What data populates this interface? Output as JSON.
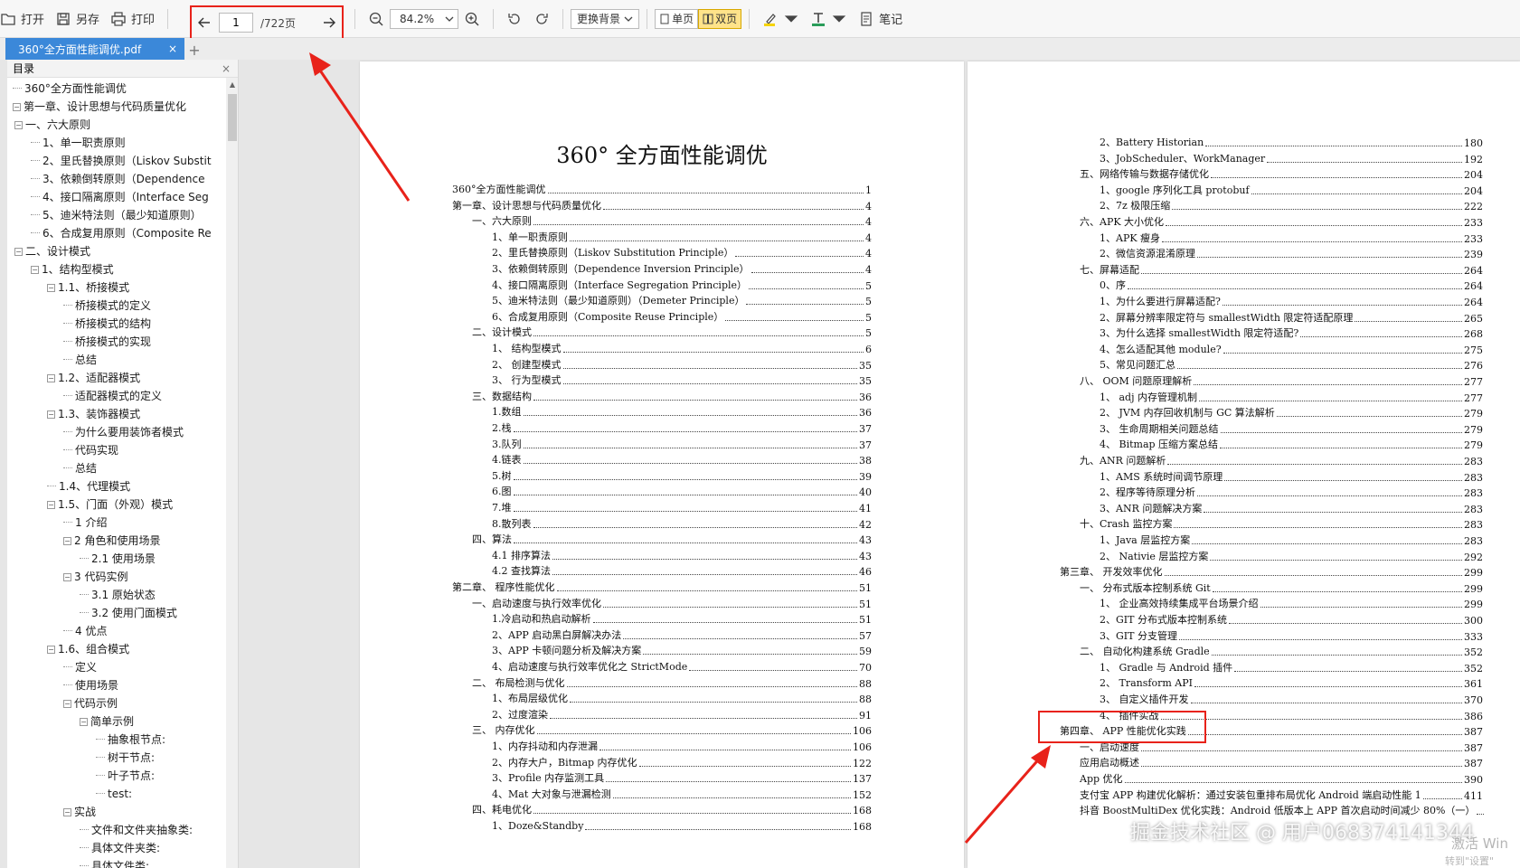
{
  "toolbar": {
    "open_label": "打开",
    "save_as_label": "另存",
    "print_label": "打印",
    "page_current": "1",
    "page_total": "/722页",
    "zoom": "84.2%",
    "background_label": "更换背景",
    "single_page_label": "单页",
    "double_page_label": "双页",
    "note_label": "笔记"
  },
  "tab": {
    "name": "360°全方面性能调优.pdf",
    "close": "×",
    "add": "+"
  },
  "sidebar": {
    "title": "目录",
    "close": "×",
    "items": [
      {
        "text": "360°全方面性能调优",
        "level": 0,
        "exp": ""
      },
      {
        "text": "第一章、设计思想与代码质量优化",
        "level": 0,
        "exp": "−"
      },
      {
        "text": "一、六大原则",
        "level": 1,
        "exp": "−"
      },
      {
        "text": "1、单一职责原则",
        "level": 2,
        "exp": ""
      },
      {
        "text": "2、里氏替换原则（Liskov Substit",
        "level": 2,
        "exp": ""
      },
      {
        "text": "3、依赖倒转原则（Dependence",
        "level": 2,
        "exp": ""
      },
      {
        "text": "4、接口隔离原则（Interface Seg",
        "level": 2,
        "exp": ""
      },
      {
        "text": "5、迪米特法则（最少知道原则）",
        "level": 2,
        "exp": ""
      },
      {
        "text": "6、合成复用原则（Composite Re",
        "level": 2,
        "exp": ""
      },
      {
        "text": "二、设计模式",
        "level": 1,
        "exp": "−"
      },
      {
        "text": "1、结构型模式",
        "level": 2,
        "exp": "−"
      },
      {
        "text": "1.1、桥接模式",
        "level": 3,
        "exp": "−"
      },
      {
        "text": "桥接模式的定义",
        "level": 4,
        "exp": ""
      },
      {
        "text": "桥接模式的结构",
        "level": 4,
        "exp": ""
      },
      {
        "text": "桥接模式的实现",
        "level": 4,
        "exp": ""
      },
      {
        "text": "总结",
        "level": 4,
        "exp": ""
      },
      {
        "text": "1.2、适配器模式",
        "level": 3,
        "exp": "−"
      },
      {
        "text": "适配器模式的定义",
        "level": 4,
        "exp": ""
      },
      {
        "text": "1.3、装饰器模式",
        "level": 3,
        "exp": "−"
      },
      {
        "text": "为什么要用装饰者模式",
        "level": 4,
        "exp": ""
      },
      {
        "text": "代码实现",
        "level": 4,
        "exp": ""
      },
      {
        "text": "总结",
        "level": 4,
        "exp": ""
      },
      {
        "text": "1.4、代理模式",
        "level": 3,
        "exp": ""
      },
      {
        "text": "1.5、门面（外观）模式",
        "level": 3,
        "exp": "−"
      },
      {
        "text": "1 介绍",
        "level": 4,
        "exp": ""
      },
      {
        "text": "2 角色和使用场景",
        "level": 4,
        "exp": "−"
      },
      {
        "text": "2.1 使用场景",
        "level": 5,
        "exp": ""
      },
      {
        "text": "3 代码实例",
        "level": 4,
        "exp": "−"
      },
      {
        "text": "3.1 原始状态",
        "level": 5,
        "exp": ""
      },
      {
        "text": "3.2 使用门面模式",
        "level": 5,
        "exp": ""
      },
      {
        "text": "4 优点",
        "level": 4,
        "exp": ""
      },
      {
        "text": "1.6、组合模式",
        "level": 3,
        "exp": "−"
      },
      {
        "text": "定义",
        "level": 4,
        "exp": ""
      },
      {
        "text": "使用场景",
        "level": 4,
        "exp": ""
      },
      {
        "text": "代码示例",
        "level": 4,
        "exp": "−"
      },
      {
        "text": "简单示例",
        "level": 5,
        "exp": "−"
      },
      {
        "text": "抽象根节点:",
        "level": 6,
        "exp": ""
      },
      {
        "text": "树干节点:",
        "level": 6,
        "exp": ""
      },
      {
        "text": "叶子节点:",
        "level": 6,
        "exp": ""
      },
      {
        "text": "test:",
        "level": 6,
        "exp": ""
      },
      {
        "text": "实战",
        "level": 4,
        "exp": "−"
      },
      {
        "text": "文件和文件夹抽象类:",
        "level": 5,
        "exp": ""
      },
      {
        "text": "具体文件夹类:",
        "level": 5,
        "exp": ""
      },
      {
        "text": "具体文件类:",
        "level": 5,
        "exp": ""
      }
    ]
  },
  "left_page": {
    "title": "360° 全方面性能调优",
    "entries": [
      {
        "text": "360°全方面性能调优",
        "page": "1",
        "indent": 0
      },
      {
        "text": "第一章、设计思想与代码质量优化",
        "page": "4",
        "indent": 0
      },
      {
        "text": "一、六大原则",
        "page": "4",
        "indent": 1
      },
      {
        "text": "1、单一职责原则",
        "page": "4",
        "indent": 2
      },
      {
        "text": "2、里氏替换原则（Liskov Substitution Principle）",
        "page": "4",
        "indent": 2
      },
      {
        "text": "3、依赖倒转原则（Dependence Inversion Principle）",
        "page": "4",
        "indent": 2
      },
      {
        "text": "4、接口隔离原则（Interface Segregation Principle）",
        "page": "5",
        "indent": 2
      },
      {
        "text": "5、迪米特法则（最少知道原则）（Demeter Principle）",
        "page": "5",
        "indent": 2
      },
      {
        "text": "6、合成复用原则（Composite Reuse Principle）",
        "page": "5",
        "indent": 2
      },
      {
        "text": "二、设计模式",
        "page": "5",
        "indent": 1
      },
      {
        "text": "1、 结构型模式",
        "page": "6",
        "indent": 2
      },
      {
        "text": "2、 创建型模式",
        "page": "35",
        "indent": 2
      },
      {
        "text": "3、 行为型模式",
        "page": "35",
        "indent": 2
      },
      {
        "text": "三、数据结构",
        "page": "36",
        "indent": 1
      },
      {
        "text": "1.数组",
        "page": "36",
        "indent": 2
      },
      {
        "text": "2.栈",
        "page": "37",
        "indent": 2
      },
      {
        "text": "3.队列",
        "page": "37",
        "indent": 2
      },
      {
        "text": "4.链表",
        "page": "38",
        "indent": 2
      },
      {
        "text": "5.树",
        "page": "39",
        "indent": 2
      },
      {
        "text": "6.图",
        "page": "40",
        "indent": 2
      },
      {
        "text": "7.堆",
        "page": "41",
        "indent": 2
      },
      {
        "text": "8.散列表",
        "page": "42",
        "indent": 2
      },
      {
        "text": "四、算法",
        "page": "43",
        "indent": 1
      },
      {
        "text": "4.1 排序算法",
        "page": "43",
        "indent": 2
      },
      {
        "text": "4.2 查找算法",
        "page": "46",
        "indent": 2
      },
      {
        "text": "第二章、 程序性能优化",
        "page": "51",
        "indent": 0
      },
      {
        "text": "一、启动速度与执行效率优化",
        "page": "51",
        "indent": 1
      },
      {
        "text": "1.冷启动和热启动解析",
        "page": "51",
        "indent": 2
      },
      {
        "text": "2、APP 启动黑白屏解决办法",
        "page": "57",
        "indent": 2
      },
      {
        "text": "3、APP 卡顿问题分析及解决方案",
        "page": "59",
        "indent": 2
      },
      {
        "text": "4、启动速度与执行效率优化之 StrictMode",
        "page": "70",
        "indent": 2
      },
      {
        "text": "二、 布局检测与优化",
        "page": "88",
        "indent": 1
      },
      {
        "text": "1、布局层级优化",
        "page": "88",
        "indent": 2
      },
      {
        "text": "2、过度渲染",
        "page": "91",
        "indent": 2
      },
      {
        "text": "三、 内存优化",
        "page": "106",
        "indent": 1
      },
      {
        "text": "1、内存抖动和内存泄漏",
        "page": "106",
        "indent": 2
      },
      {
        "text": "2、内存大户，Bitmap 内存优化",
        "page": "122",
        "indent": 2
      },
      {
        "text": "3、Profile 内存监测工具",
        "page": "137",
        "indent": 2
      },
      {
        "text": "4、Mat 大对象与泄漏检测",
        "page": "152",
        "indent": 2
      },
      {
        "text": "四、耗电优化",
        "page": "168",
        "indent": 1
      },
      {
        "text": "1、Doze&Standby",
        "page": "168",
        "indent": 2
      }
    ]
  },
  "right_page": {
    "entries": [
      {
        "text": "2、Battery Historian",
        "page": "180",
        "indent": 2
      },
      {
        "text": "3、JobScheduler、WorkManager",
        "page": "192",
        "indent": 2
      },
      {
        "text": "五、网络传输与数据存储优化",
        "page": "204",
        "indent": 1
      },
      {
        "text": "1、google 序列化工具 protobuf",
        "page": "204",
        "indent": 2
      },
      {
        "text": "2、7z 极限压缩",
        "page": "222",
        "indent": 2
      },
      {
        "text": "六、APK 大小优化",
        "page": "233",
        "indent": 1
      },
      {
        "text": "1、APK 瘦身",
        "page": "233",
        "indent": 2
      },
      {
        "text": "2、微信资源混淆原理",
        "page": "239",
        "indent": 2
      },
      {
        "text": "七、屏幕适配",
        "page": "264",
        "indent": 1
      },
      {
        "text": "0、序",
        "page": "264",
        "indent": 2
      },
      {
        "text": "1、为什么要进行屏幕适配?",
        "page": "264",
        "indent": 2
      },
      {
        "text": "2、屏幕分辨率限定符与 smallestWidth 限定符适配原理",
        "page": "265",
        "indent": 2
      },
      {
        "text": "3、为什么选择 smallestWidth 限定符适配?",
        "page": "268",
        "indent": 2
      },
      {
        "text": "4、怎么适配其他 module?",
        "page": "275",
        "indent": 2
      },
      {
        "text": "5、常见问题汇总",
        "page": "276",
        "indent": 2
      },
      {
        "text": "八、 OOM 问题原理解析",
        "page": "277",
        "indent": 1
      },
      {
        "text": "1、 adj 内存管理机制",
        "page": "277",
        "indent": 2
      },
      {
        "text": "2、 JVM 内存回收机制与 GC 算法解析",
        "page": "279",
        "indent": 2
      },
      {
        "text": "3、 生命周期相关问题总结",
        "page": "279",
        "indent": 2
      },
      {
        "text": "4、 Bitmap 压缩方案总结",
        "page": "279",
        "indent": 2
      },
      {
        "text": "九、ANR 问题解析",
        "page": "283",
        "indent": 1
      },
      {
        "text": "1、AMS 系统时间调节原理",
        "page": "283",
        "indent": 2
      },
      {
        "text": "2、程序等待原理分析",
        "page": "283",
        "indent": 2
      },
      {
        "text": "3、ANR 问题解决方案",
        "page": "283",
        "indent": 2
      },
      {
        "text": "十、Crash 监控方案",
        "page": "283",
        "indent": 1
      },
      {
        "text": "1、Java 层监控方案",
        "page": "283",
        "indent": 2
      },
      {
        "text": "2、 Nativie 层监控方案",
        "page": "292",
        "indent": 2
      },
      {
        "text": "第三章、 开发效率优化",
        "page": "299",
        "indent": 0
      },
      {
        "text": "一、 分布式版本控制系统 Git",
        "page": "299",
        "indent": 1
      },
      {
        "text": "1、 企业高效持续集成平台场景介绍",
        "page": "299",
        "indent": 2
      },
      {
        "text": "2、GIT 分布式版本控制系统",
        "page": "300",
        "indent": 2
      },
      {
        "text": "3、GIT 分支管理",
        "page": "333",
        "indent": 2
      },
      {
        "text": "二、 自动化构建系统 Gradle",
        "page": "352",
        "indent": 1
      },
      {
        "text": "1、 Gradle 与 Android 插件",
        "page": "352",
        "indent": 2
      },
      {
        "text": "2、 Transform API",
        "page": "361",
        "indent": 2
      },
      {
        "text": "3、 自定义插件开发",
        "page": "370",
        "indent": 2
      },
      {
        "text": "4、 插件实战",
        "page": "386",
        "indent": 2
      },
      {
        "text": "第四章、 APP 性能优化实践",
        "page": "387",
        "indent": 0
      },
      {
        "text": "一、启动速度",
        "page": "387",
        "indent": 1
      },
      {
        "text": "应用启动概述",
        "page": "387",
        "indent": 1
      },
      {
        "text": "App 优化",
        "page": "390",
        "indent": 1
      },
      {
        "text": "支付宝 APP 构建优化解析：通过安装包重排布局优化 Android 端启动性能 1",
        "page": "411",
        "indent": 1
      },
      {
        "text": "抖音 BoostMultiDex 优化实践：Android 低版本上 APP 首次启动时间减少 80%（一）",
        "page": "",
        "indent": 1
      }
    ]
  },
  "watermark": "掘金技术社区 @ 用户068374141344",
  "activate_text": "激活 Win",
  "activate_sub": "转到\"设置\"",
  "colors": {
    "accent": "#3b88d9",
    "annotation": "#e8221a"
  }
}
